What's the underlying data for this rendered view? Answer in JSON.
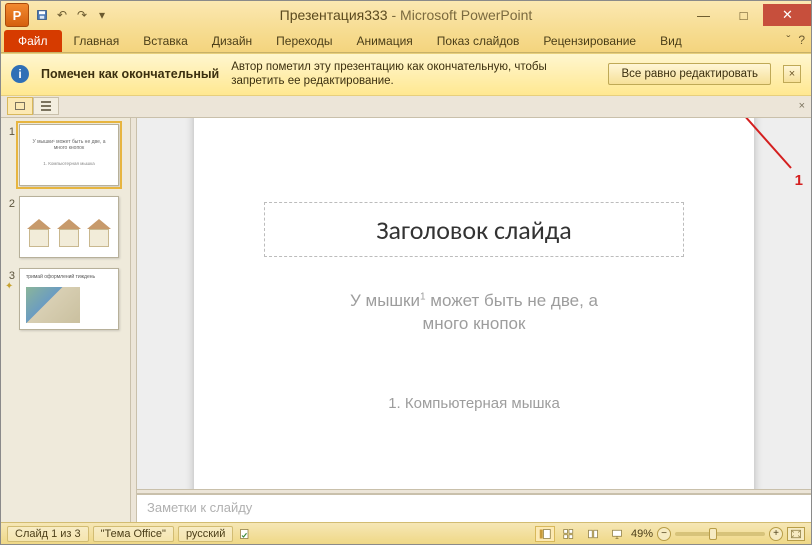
{
  "window": {
    "doc_name": "Презентация333",
    "app_name": "Microsoft PowerPoint"
  },
  "qat": {
    "save": "save-icon",
    "undo": "undo-icon",
    "redo": "redo-icon",
    "customize": "customize-icon"
  },
  "ribbon": {
    "file": "Файл",
    "tabs": [
      "Главная",
      "Вставка",
      "Дизайн",
      "Переходы",
      "Анимация",
      "Показ слайдов",
      "Рецензирование",
      "Вид"
    ]
  },
  "message_bar": {
    "title": "Помечен как окончательный",
    "body": "Автор пометил эту презентацию как окончательную, чтобы запретить ее редактирование.",
    "button": "Все равно редактировать",
    "close": "×"
  },
  "annotation": {
    "label": "1"
  },
  "thumbs": [
    {
      "num": "1",
      "kind": "title",
      "title": "У мышки¹ может быть не две, а много кнопок",
      "sub": "1. Компьютерная мышка"
    },
    {
      "num": "2",
      "kind": "houses"
    },
    {
      "num": "3",
      "kind": "photo",
      "caption": "тримай оформлений  тиждень"
    }
  ],
  "slide": {
    "title_placeholder": "Заголовок слайда",
    "body_line1": "У мышки",
    "body_sup": "1",
    "body_line1b": " может быть не две, а",
    "body_line2": "много кнопок",
    "footnote": "1. Компьютерная мышка"
  },
  "notes": {
    "placeholder": "Заметки к слайду"
  },
  "status": {
    "slide_counter": "Слайд 1 из 3",
    "theme": "\"Тема Office\"",
    "lang": "русский",
    "zoom_pct": "49%"
  }
}
